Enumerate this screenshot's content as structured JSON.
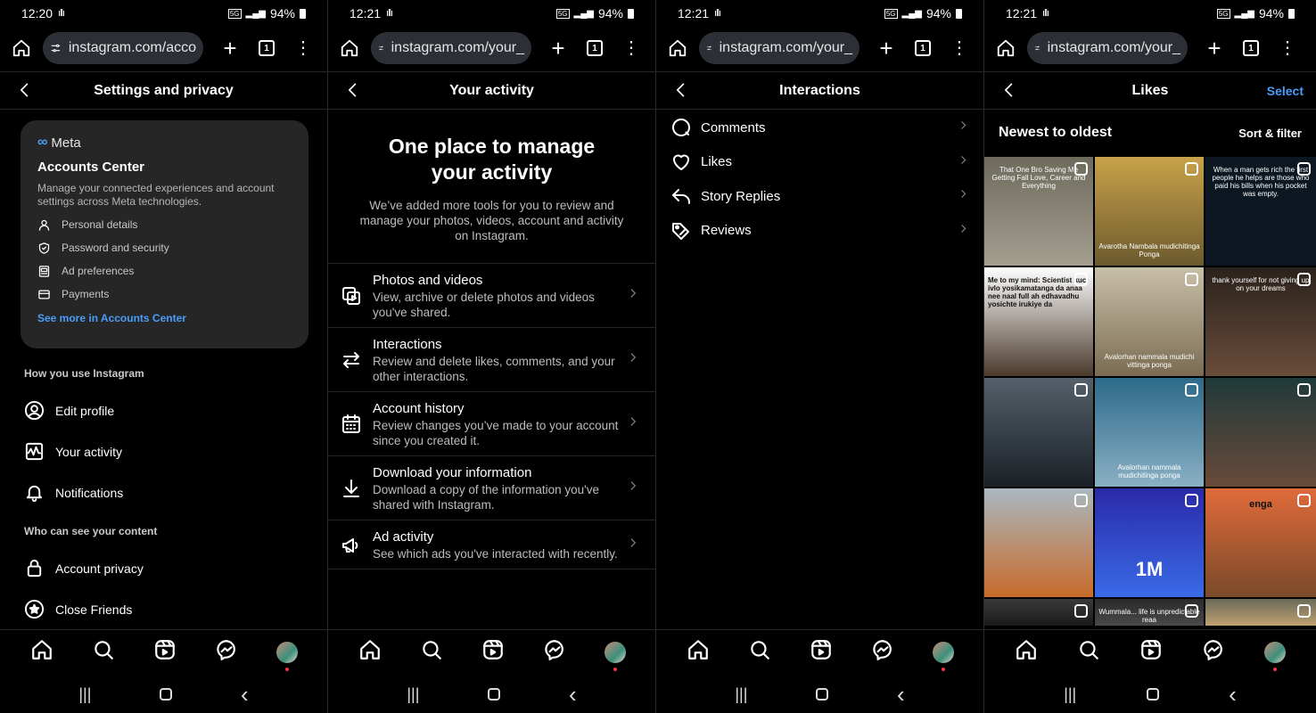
{
  "status_bars": [
    {
      "time": "12:20",
      "battery": "94%"
    },
    {
      "time": "12:21",
      "battery": "94%"
    },
    {
      "time": "12:21",
      "battery": "94%"
    },
    {
      "time": "12:21",
      "battery": "94%"
    }
  ],
  "status_misc": {
    "wave": "ıllı",
    "net": "5G"
  },
  "browser": {
    "urls": [
      "instagram.com/acco",
      "instagram.com/your_",
      "instagram.com/your_",
      "instagram.com/your_"
    ],
    "tab_count": "1",
    "plus": "+",
    "menu": "⋮"
  },
  "panel1": {
    "title": "Settings and privacy",
    "meta_label": "Meta",
    "accounts_center": "Accounts Center",
    "accounts_desc": "Manage your connected experiences and account settings across Meta technologies.",
    "ac_items": [
      "Personal details",
      "Password and security",
      "Ad preferences",
      "Payments"
    ],
    "see_more": "See more in Accounts Center",
    "section1": "How you use Instagram",
    "items1": [
      "Edit profile",
      "Your activity",
      "Notifications"
    ],
    "section2": "Who can see your content",
    "items2": [
      "Account privacy",
      "Close Friends"
    ]
  },
  "panel2": {
    "title": "Your activity",
    "hero_title": "One place to manage your activity",
    "hero_desc": "We’ve added more tools for you to review and manage your photos, videos, account and activity on Instagram.",
    "items": [
      {
        "title": "Photos and videos",
        "desc": "View, archive or delete photos and videos you've shared."
      },
      {
        "title": "Interactions",
        "desc": "Review and delete likes, comments, and your other interactions."
      },
      {
        "title": "Account history",
        "desc": "Review changes you’ve made to your account since you created it."
      },
      {
        "title": "Download your information",
        "desc": "Download a copy of the information you've shared with Instagram."
      },
      {
        "title": "Ad activity",
        "desc": "See which ads you've interacted with recently."
      }
    ]
  },
  "panel3": {
    "title": "Interactions",
    "items": [
      "Comments",
      "Likes",
      "Story Replies",
      "Reviews"
    ]
  },
  "panel4": {
    "title": "Likes",
    "select": "Select",
    "sort_title": "Newest to oldest",
    "sort_filter": "Sort & filter",
    "tile_captions": [
      "That One Bro Saving Me Getting Fall Love, Career and Everything",
      "Avarotha Nambala mudichitinga Ponga",
      "When a man gets rich the first people he helps are those who paid his bills when his pocket was empty.",
      "Me to my mind: Scientist kuc, ivlo yosikamatanga da anaa nee naal full ah edhavadhu yosichte irukiye da",
      "Avalorhan nammala mudichi vittinga ponga",
      "thank yourself for not giving up on your dreams",
      "",
      "Avalorhan nammala mudichitinga ponga",
      "",
      "",
      "1M",
      "enga",
      "",
      "Wummala... life is unpredictable reaa",
      ""
    ],
    "tile_colors": [
      [
        "#6d6a5c",
        "#a59f90"
      ],
      [
        "#c9a24a",
        "#6c5a2e"
      ],
      [
        "#0c1722",
        "#0c1722"
      ],
      [
        "#ffffff",
        "#4a3a2c"
      ],
      [
        "#c9c0a8",
        "#7a6c52"
      ],
      [
        "#2a221c",
        "#6a4c3a"
      ],
      [
        "#55606a",
        "#1a2026"
      ],
      [
        "#2d6a8a",
        "#8ab0c4"
      ],
      [
        "#1f3a3a",
        "#6a4a3a"
      ],
      [
        "#a9b8c0",
        "#c86a2a"
      ],
      [
        "#2a2aa8",
        "#3a6ae8"
      ],
      [
        "#e06a3a",
        "#7a4a2a"
      ],
      [
        "#3a3a3a",
        "#1a1a1a"
      ],
      [
        "#2a2a2a",
        "#4a4a4a"
      ],
      [
        "#6a6a5a",
        "#c0a070"
      ]
    ]
  },
  "sysnav": {
    "recent": "|||",
    "back": "‹"
  }
}
